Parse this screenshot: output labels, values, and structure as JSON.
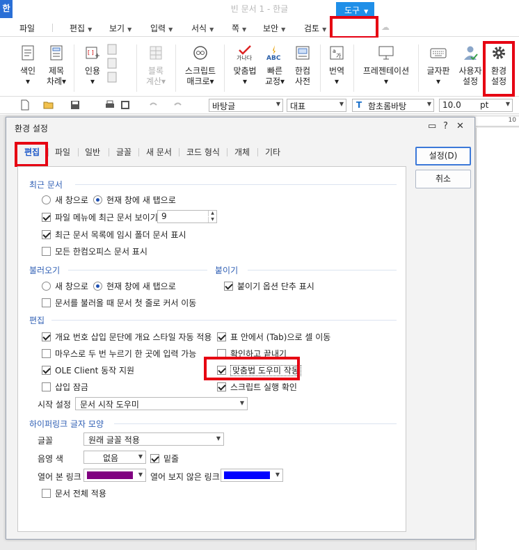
{
  "app": {
    "logo_text": "한",
    "window_title": "빈 문서 1 - 한글"
  },
  "menubar": {
    "items": [
      {
        "label": "파일"
      },
      {
        "label": "편집"
      },
      {
        "label": "보기"
      },
      {
        "label": "입력"
      },
      {
        "label": "서식"
      },
      {
        "label": "쪽"
      },
      {
        "label": "보안"
      },
      {
        "label": "검토"
      }
    ],
    "active": {
      "label": "도구"
    }
  },
  "ribbon": {
    "buttons": [
      {
        "label1": "색인",
        "label2": "▾"
      },
      {
        "label1": "제목",
        "label2": "차례▾"
      },
      {
        "label1": "인용",
        "label2": "▾"
      },
      {
        "label1": "블록",
        "label2": "계산▾"
      },
      {
        "label1": "스크립트",
        "label2": "매크로▾"
      },
      {
        "label1": "맞춤법",
        "label2": "▾"
      },
      {
        "label1": "빠른",
        "label2": "교정▾"
      },
      {
        "label1": "한컴",
        "label2": "사전"
      },
      {
        "label1": "번역",
        "label2": "▾"
      },
      {
        "label1": "프레젠테이션",
        "label2": "▾"
      },
      {
        "label1": "글자판",
        "label2": "▾"
      },
      {
        "label1": "사용자",
        "label2": "설정"
      },
      {
        "label1": "환경",
        "label2": "설정"
      }
    ],
    "icon_texts": {
      "spell": "가나다",
      "abc": "ABC"
    }
  },
  "format_bar": {
    "style": "바탕글",
    "language": "대표",
    "font": "함초롬바탕",
    "size": "10.0",
    "unit": "pt"
  },
  "ruler": {
    "number": "10"
  },
  "dialog": {
    "title": "환경 설정",
    "tabs": [
      {
        "label": "편집"
      },
      {
        "label": "파일"
      },
      {
        "label": "일반"
      },
      {
        "label": "글꼴"
      },
      {
        "label": "새 문서"
      },
      {
        "label": "코드 형식"
      },
      {
        "label": "개체"
      },
      {
        "label": "기타"
      }
    ],
    "buttons": {
      "ok": "설정(D)",
      "cancel": "취소"
    },
    "recent": {
      "title": "최근 문서",
      "radio_new_window": "새 창으로",
      "radio_new_tab": "현재 창에 새 탭으로",
      "show_recent": "파일 메뉴에 최근 문서 보이기",
      "recent_count": "9",
      "show_temp": "최근 문서 목록에 임시 폴더 문서 표시",
      "show_all": "모든 한컴오피스 문서 표시"
    },
    "load": {
      "title": "불러오기",
      "radio_new_window": "새 창으로",
      "radio_new_tab": "현재 창에 새 탭으로",
      "move_first_line": "문서를 불러올 때 문서 첫 줄로 커서 이동"
    },
    "paste": {
      "title": "붙이기",
      "show_shortcut": "붙이기 옵션 단추 표시"
    },
    "edit": {
      "title": "편집",
      "auto_style": "개요 번호 삽입 문단에 개요 스타일 자동 적용",
      "tab_move": "표 안에서 (Tab)으로 셀 이동",
      "double_click": "마우스로 두 번 누르기 한 곳에 입력 가능",
      "confirm_close": "확인하고 끝내기",
      "ole_client": "OLE Client 동작 지원",
      "spell_helper": "맞춤법 도우미 작동",
      "insert_lock": "삽입 잠금",
      "script_confirm": "스크립트 실행 확인",
      "start_label": "시작 설정",
      "start_value": "문서 시작 도우미"
    },
    "hyperlink": {
      "title": "하이퍼링크 글자 모양",
      "font_label": "글꼴",
      "font_value": "원래 글꼴 적용",
      "shade_label": "음영 색",
      "shade_value": "없음",
      "underline": "밑줄",
      "visited_label": "열어 본 링크",
      "visited_color": "#800080",
      "unvisited_label": "열어 보지 않은 링크",
      "unvisited_color": "#0000ff",
      "apply_all": "문서 전체 적용"
    }
  }
}
